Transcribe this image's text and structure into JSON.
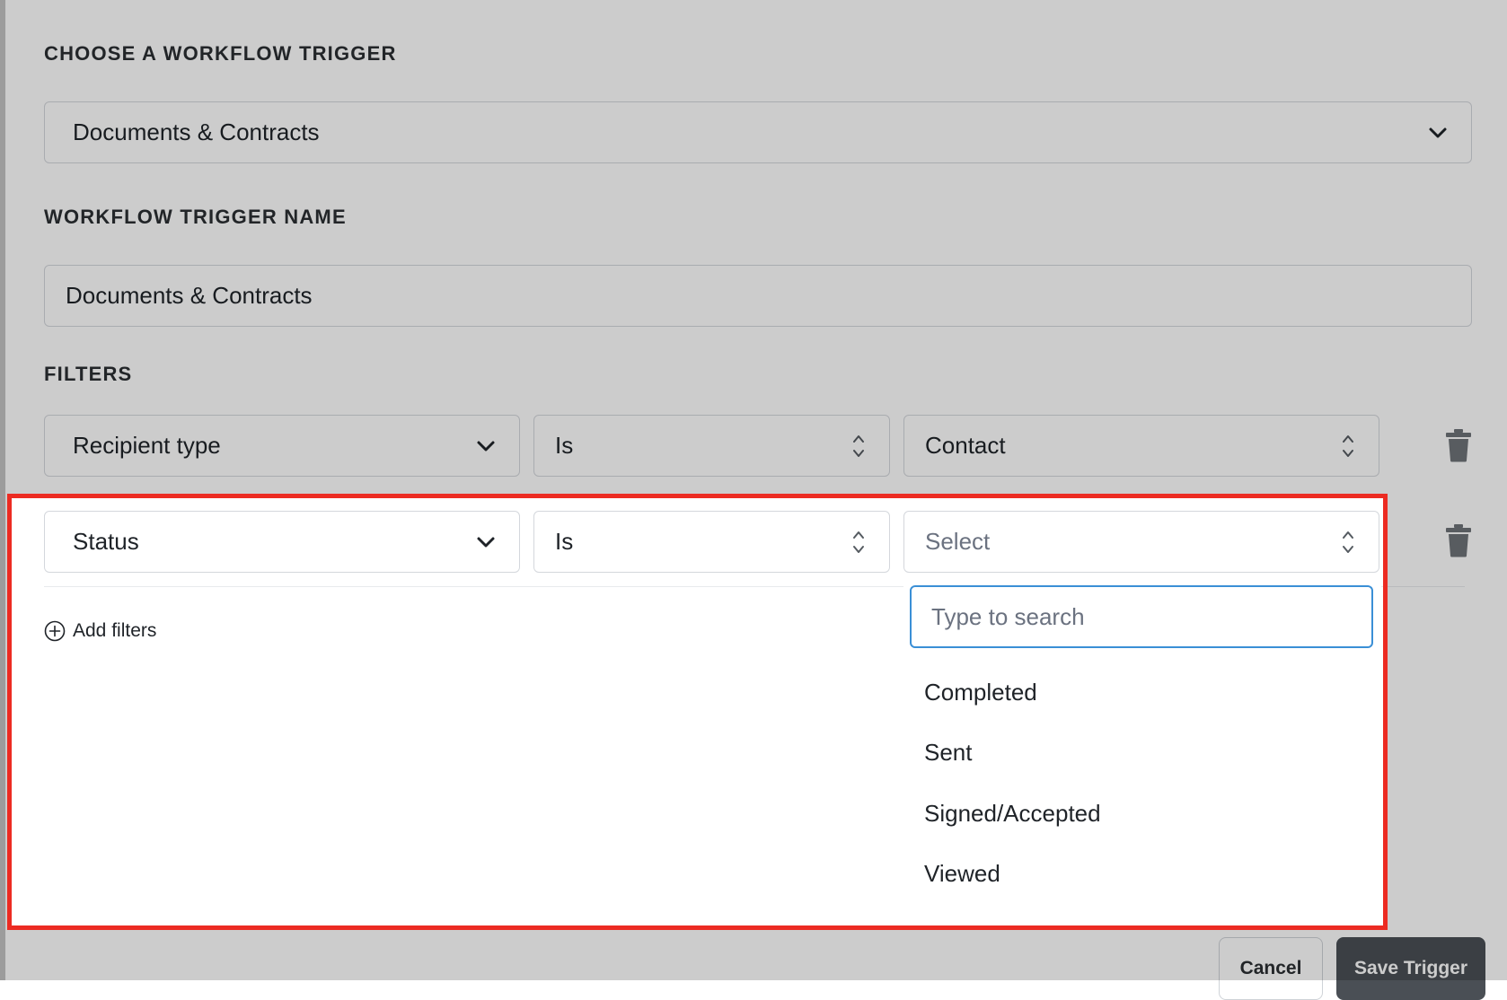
{
  "trigger_section": {
    "label": "CHOOSE A WORKFLOW TRIGGER",
    "selected": "Documents & Contracts"
  },
  "name_section": {
    "label": "WORKFLOW TRIGGER NAME",
    "value": "Documents & Contracts"
  },
  "filters": {
    "label": "FILTERS",
    "rows": [
      {
        "field": "Recipient type",
        "operator": "Is",
        "value": "Contact"
      },
      {
        "field": "Status",
        "operator": "Is",
        "value_placeholder": "Select"
      }
    ],
    "add_label": "Add filters"
  },
  "status_dropdown": {
    "search_placeholder": "Type to search",
    "options": [
      "Completed",
      "Sent",
      "Signed/Accepted",
      "Viewed"
    ]
  },
  "footer": {
    "cancel_label": "Cancel",
    "save_label": "Save Trigger"
  },
  "icons": {
    "select_arrow": "chevron-down-icon",
    "updown": "updown-arrows-icon",
    "delete": "trash-icon",
    "add": "plus-circle-icon"
  },
  "colors": {
    "highlight": "#ec2b22",
    "focus_border": "#3a8fd6",
    "primary_button": "#4a4f55"
  }
}
